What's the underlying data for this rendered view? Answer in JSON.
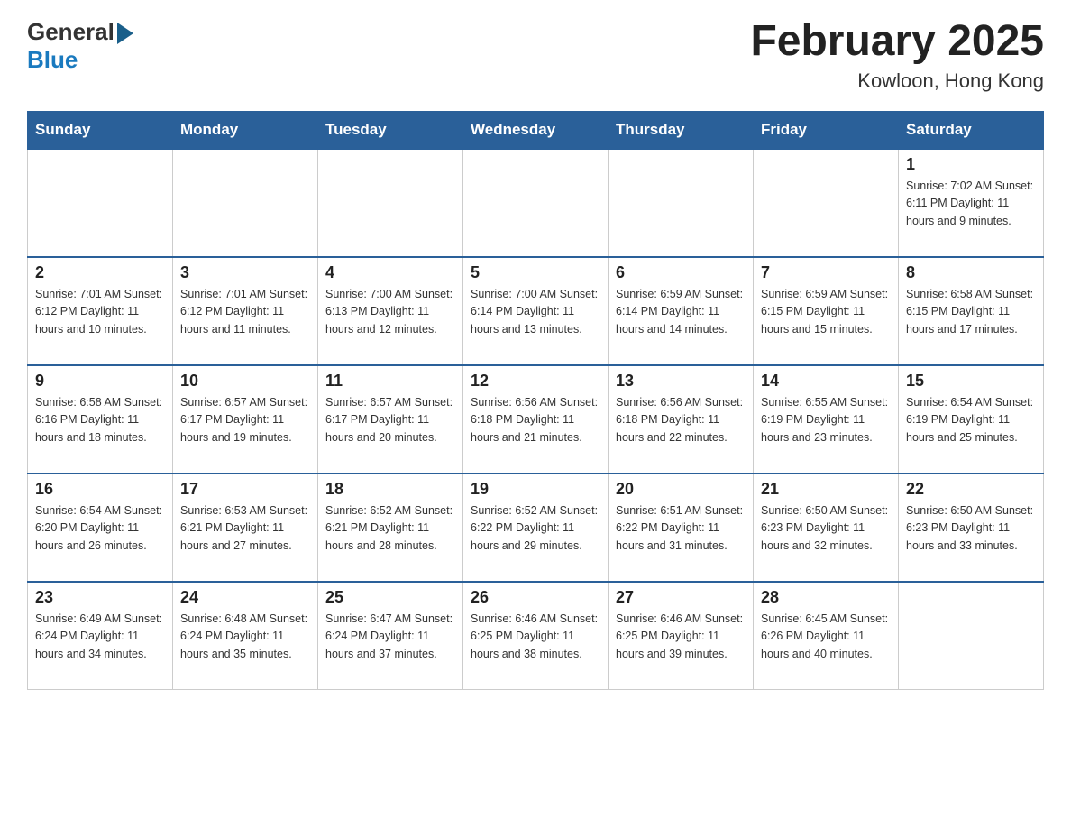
{
  "header": {
    "title": "February 2025",
    "subtitle": "Kowloon, Hong Kong",
    "logo_general": "General",
    "logo_blue": "Blue"
  },
  "weekdays": [
    "Sunday",
    "Monday",
    "Tuesday",
    "Wednesday",
    "Thursday",
    "Friday",
    "Saturday"
  ],
  "weeks": [
    [
      {
        "day": "",
        "info": ""
      },
      {
        "day": "",
        "info": ""
      },
      {
        "day": "",
        "info": ""
      },
      {
        "day": "",
        "info": ""
      },
      {
        "day": "",
        "info": ""
      },
      {
        "day": "",
        "info": ""
      },
      {
        "day": "1",
        "info": "Sunrise: 7:02 AM\nSunset: 6:11 PM\nDaylight: 11 hours\nand 9 minutes."
      }
    ],
    [
      {
        "day": "2",
        "info": "Sunrise: 7:01 AM\nSunset: 6:12 PM\nDaylight: 11 hours\nand 10 minutes."
      },
      {
        "day": "3",
        "info": "Sunrise: 7:01 AM\nSunset: 6:12 PM\nDaylight: 11 hours\nand 11 minutes."
      },
      {
        "day": "4",
        "info": "Sunrise: 7:00 AM\nSunset: 6:13 PM\nDaylight: 11 hours\nand 12 minutes."
      },
      {
        "day": "5",
        "info": "Sunrise: 7:00 AM\nSunset: 6:14 PM\nDaylight: 11 hours\nand 13 minutes."
      },
      {
        "day": "6",
        "info": "Sunrise: 6:59 AM\nSunset: 6:14 PM\nDaylight: 11 hours\nand 14 minutes."
      },
      {
        "day": "7",
        "info": "Sunrise: 6:59 AM\nSunset: 6:15 PM\nDaylight: 11 hours\nand 15 minutes."
      },
      {
        "day": "8",
        "info": "Sunrise: 6:58 AM\nSunset: 6:15 PM\nDaylight: 11 hours\nand 17 minutes."
      }
    ],
    [
      {
        "day": "9",
        "info": "Sunrise: 6:58 AM\nSunset: 6:16 PM\nDaylight: 11 hours\nand 18 minutes."
      },
      {
        "day": "10",
        "info": "Sunrise: 6:57 AM\nSunset: 6:17 PM\nDaylight: 11 hours\nand 19 minutes."
      },
      {
        "day": "11",
        "info": "Sunrise: 6:57 AM\nSunset: 6:17 PM\nDaylight: 11 hours\nand 20 minutes."
      },
      {
        "day": "12",
        "info": "Sunrise: 6:56 AM\nSunset: 6:18 PM\nDaylight: 11 hours\nand 21 minutes."
      },
      {
        "day": "13",
        "info": "Sunrise: 6:56 AM\nSunset: 6:18 PM\nDaylight: 11 hours\nand 22 minutes."
      },
      {
        "day": "14",
        "info": "Sunrise: 6:55 AM\nSunset: 6:19 PM\nDaylight: 11 hours\nand 23 minutes."
      },
      {
        "day": "15",
        "info": "Sunrise: 6:54 AM\nSunset: 6:19 PM\nDaylight: 11 hours\nand 25 minutes."
      }
    ],
    [
      {
        "day": "16",
        "info": "Sunrise: 6:54 AM\nSunset: 6:20 PM\nDaylight: 11 hours\nand 26 minutes."
      },
      {
        "day": "17",
        "info": "Sunrise: 6:53 AM\nSunset: 6:21 PM\nDaylight: 11 hours\nand 27 minutes."
      },
      {
        "day": "18",
        "info": "Sunrise: 6:52 AM\nSunset: 6:21 PM\nDaylight: 11 hours\nand 28 minutes."
      },
      {
        "day": "19",
        "info": "Sunrise: 6:52 AM\nSunset: 6:22 PM\nDaylight: 11 hours\nand 29 minutes."
      },
      {
        "day": "20",
        "info": "Sunrise: 6:51 AM\nSunset: 6:22 PM\nDaylight: 11 hours\nand 31 minutes."
      },
      {
        "day": "21",
        "info": "Sunrise: 6:50 AM\nSunset: 6:23 PM\nDaylight: 11 hours\nand 32 minutes."
      },
      {
        "day": "22",
        "info": "Sunrise: 6:50 AM\nSunset: 6:23 PM\nDaylight: 11 hours\nand 33 minutes."
      }
    ],
    [
      {
        "day": "23",
        "info": "Sunrise: 6:49 AM\nSunset: 6:24 PM\nDaylight: 11 hours\nand 34 minutes."
      },
      {
        "day": "24",
        "info": "Sunrise: 6:48 AM\nSunset: 6:24 PM\nDaylight: 11 hours\nand 35 minutes."
      },
      {
        "day": "25",
        "info": "Sunrise: 6:47 AM\nSunset: 6:24 PM\nDaylight: 11 hours\nand 37 minutes."
      },
      {
        "day": "26",
        "info": "Sunrise: 6:46 AM\nSunset: 6:25 PM\nDaylight: 11 hours\nand 38 minutes."
      },
      {
        "day": "27",
        "info": "Sunrise: 6:46 AM\nSunset: 6:25 PM\nDaylight: 11 hours\nand 39 minutes."
      },
      {
        "day": "28",
        "info": "Sunrise: 6:45 AM\nSunset: 6:26 PM\nDaylight: 11 hours\nand 40 minutes."
      },
      {
        "day": "",
        "info": ""
      }
    ]
  ]
}
